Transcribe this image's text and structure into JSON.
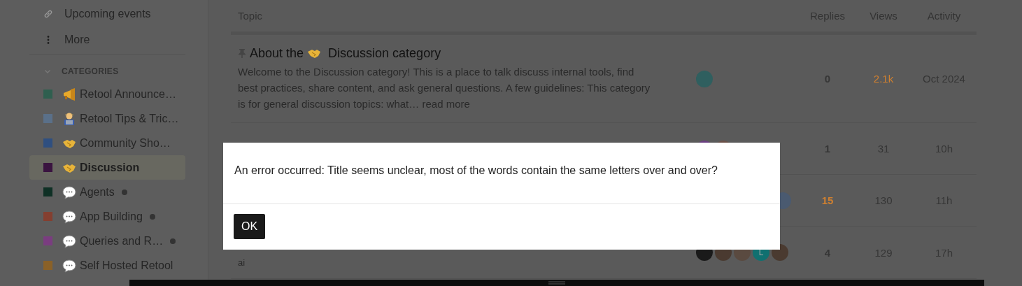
{
  "sidebar": {
    "links": [
      {
        "kind": "link",
        "label": "Upcoming events"
      },
      {
        "kind": "more",
        "label": "More"
      }
    ],
    "categories_header": {
      "label": "CATEGORIES",
      "expanded": true
    },
    "categories": [
      {
        "name": "Retool Announce…",
        "color": "#2f5f4f",
        "kind": "megaphone",
        "unread": false,
        "selected": false
      },
      {
        "name": "Retool Tips & Tric…",
        "color": "#5a7089",
        "kind": "coder",
        "unread": false,
        "selected": false
      },
      {
        "name": "Community Sho…",
        "color": "#2f4f80",
        "kind": "handshake",
        "unread": false,
        "selected": false
      },
      {
        "name": "Discussion",
        "color": "#3a1440",
        "kind": "handshake",
        "unread": false,
        "selected": true
      },
      {
        "name": "Agents",
        "color": "#0f3025",
        "kind": "speech",
        "unread": true,
        "selected": false
      },
      {
        "name": "App Building",
        "color": "#843f30",
        "kind": "speech",
        "unread": true,
        "selected": false
      },
      {
        "name": "Queries and R…",
        "color": "#7a3d80",
        "kind": "speech",
        "unread": true,
        "selected": false
      },
      {
        "name": "Self Hosted Retool",
        "color": "#8a6128",
        "kind": "speech",
        "unread": false,
        "selected": false
      }
    ]
  },
  "table": {
    "columns": [
      "Topic",
      "Replies",
      "Views",
      "Activity"
    ],
    "rows": [
      {
        "pinned": true,
        "title_parts": [
          {
            "kind": "text",
            "text": "About the"
          },
          {
            "kind": "handshake"
          },
          {
            "kind": "text",
            "text": "Discussion category"
          }
        ],
        "excerpt": "Welcome to the Discussion category! This is a place to talk discuss internal tools, find best practices, share content, and ask general questions. A few guidelines: This category is for general discussion topics: what…",
        "read_more": "read more",
        "posters": [
          {
            "color": "#2f5f5f"
          }
        ],
        "replies": "0",
        "replies_hot": false,
        "views": "2.1k",
        "views_hot": true,
        "activity": "Oct 2024"
      },
      {
        "posters": [
          {
            "color": "#6a3f80"
          },
          {
            "color": "#6a5048"
          }
        ],
        "replies": "1",
        "replies_hot": false,
        "views": "31",
        "views_hot": false,
        "activity": "10h"
      },
      {
        "posters": [
          {
            "color": "#4a5a70"
          }
        ],
        "replies": "15",
        "replies_hot": true,
        "views": "130",
        "views_hot": false,
        "activity": "11h"
      },
      {
        "tag": "ai",
        "posters": [
          {
            "color": "#1a1a1a"
          },
          {
            "color": "#4a3a30"
          },
          {
            "color": "#5a4a40"
          },
          {
            "color": "#107070",
            "letter": "L"
          },
          {
            "color": "#4a3a30"
          }
        ],
        "replies": "4",
        "replies_hot": false,
        "views": "129",
        "views_hot": false,
        "activity": "17h"
      }
    ]
  },
  "dialog": {
    "message": "An error occurred: Title seems unclear, most of the words contain the same letters over and over?",
    "button": "OK"
  }
}
